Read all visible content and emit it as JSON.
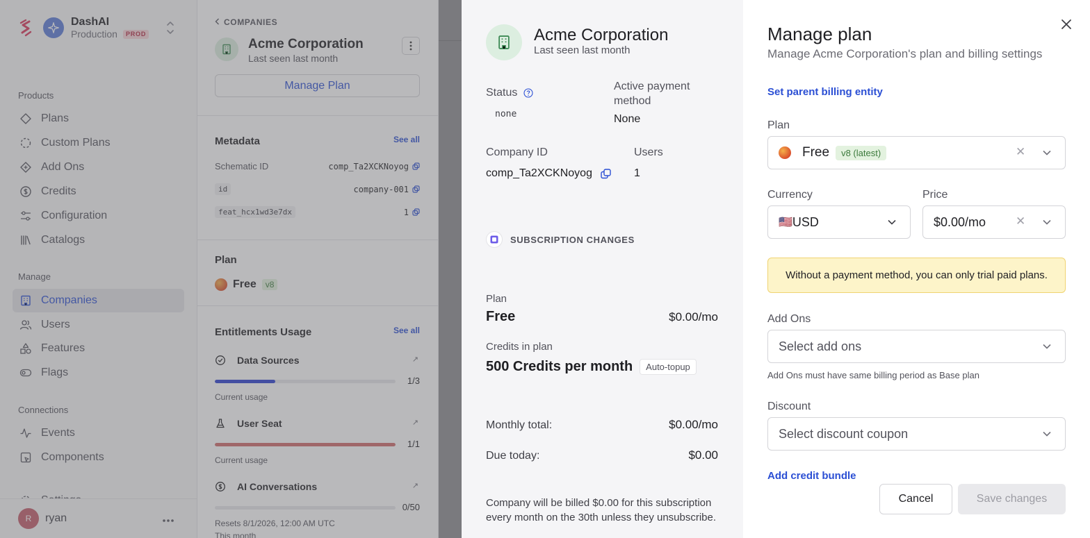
{
  "workspace": {
    "name": "DashAI",
    "environment": "Production",
    "env_badge": "PROD"
  },
  "sidebar": {
    "sections": [
      {
        "title": "Products",
        "items": [
          {
            "label": "Plans",
            "icon": "diamond-icon"
          },
          {
            "label": "Custom Plans",
            "icon": "dashed-circle-icon"
          },
          {
            "label": "Add Ons",
            "icon": "diamond-plus-icon"
          },
          {
            "label": "Credits",
            "icon": "dollar-circle-icon"
          },
          {
            "label": "Configuration",
            "icon": "sliders-icon"
          },
          {
            "label": "Catalogs",
            "icon": "books-icon"
          }
        ]
      },
      {
        "title": "Manage",
        "items": [
          {
            "label": "Companies",
            "icon": "building-icon",
            "active": true
          },
          {
            "label": "Users",
            "icon": "users-icon"
          },
          {
            "label": "Features",
            "icon": "shapes-icon"
          },
          {
            "label": "Flags",
            "icon": "toggle-icon"
          }
        ]
      },
      {
        "title": "Connections",
        "items": [
          {
            "label": "Events",
            "icon": "activity-icon"
          },
          {
            "label": "Components",
            "icon": "component-icon"
          },
          {
            "label": "Settings",
            "icon": "gear-icon"
          }
        ]
      }
    ],
    "user": {
      "initial": "R",
      "name": "ryan"
    }
  },
  "company_panel": {
    "breadcrumb": "COMPANIES",
    "name": "Acme Corporation",
    "last_seen": "Last seen last month",
    "manage_plan_label": "Manage Plan",
    "metadata": {
      "title": "Metadata",
      "see_all": "See all",
      "rows": [
        {
          "key": "Schematic ID",
          "value": "comp_Ta2XCKNoyog"
        },
        {
          "key": "id",
          "value": "company-001"
        },
        {
          "key": "feat_hcx1wd3e7dx",
          "value": "1"
        }
      ]
    },
    "plan": {
      "title": "Plan",
      "name": "Free",
      "version": "v8"
    },
    "entitlements": {
      "title": "Entitlements Usage",
      "see_all": "See all",
      "items": [
        {
          "name": "Data Sources",
          "usage": "1/3",
          "fill": 0.3333,
          "color": "#2a3fd1",
          "sub": "Current usage",
          "sub2": ""
        },
        {
          "name": "User Seat",
          "usage": "1/1",
          "fill": 1.0,
          "color": "#cf6b6b",
          "sub": "Current usage",
          "sub2": ""
        },
        {
          "name": "AI Conversations",
          "usage": "0/50",
          "fill": 0.0,
          "color": "#2a3fd1",
          "sub": "Resets 8/1/2026, 12:00 AM UTC",
          "sub2": "This month"
        }
      ]
    }
  },
  "summary": {
    "name": "Acme Corporation",
    "last_seen": "Last seen last month",
    "status_label": "Status",
    "status_value": "none",
    "payment_label": "Active payment method",
    "payment_value": "None",
    "company_id_label": "Company ID",
    "company_id_value": "comp_Ta2XCKNoyog",
    "users_label": "Users",
    "users_value": "1",
    "sub_changes_label": "SUBSCRIPTION CHANGES",
    "plan_label": "Plan",
    "plan_name": "Free",
    "plan_price": "$0.00/mo",
    "credits_label": "Credits in plan",
    "credits_value": "500 Credits per month",
    "auto_topup": "Auto-topup",
    "monthly_total_label": "Monthly total:",
    "monthly_total_value": "$0.00/mo",
    "due_today_label": "Due today:",
    "due_today_value": "$0.00",
    "billing_note": "Company will be billed $0.00 for this subscription every month on the 30th unless they unsubscribe."
  },
  "drawer": {
    "title": "Manage plan",
    "subtitle": "Manage Acme Corporation's plan and billing settings",
    "parent_billing_link": "Set parent billing entity",
    "plan_label": "Plan",
    "plan_value": "Free",
    "plan_version": "v8 (latest)",
    "currency_label": "Currency",
    "currency_flag": "🇺🇸",
    "currency_value": "USD",
    "price_label": "Price",
    "price_value": "$0.00/mo",
    "warning": "Without a payment method, you can only trial paid plans.",
    "addons_label": "Add Ons",
    "addons_placeholder": "Select add ons",
    "addons_hint": "Add Ons must have same billing period as Base plan",
    "discount_label": "Discount",
    "discount_placeholder": "Select discount coupon",
    "credit_bundle_link": "Add credit bundle",
    "cancel_label": "Cancel",
    "save_label": "Save changes"
  },
  "colors": {
    "accent": "#2b4fd4",
    "prod_badge_bg": "#f8d3d8",
    "warning_bg": "#fdf4c9",
    "overlay": "#8a8a8e"
  }
}
